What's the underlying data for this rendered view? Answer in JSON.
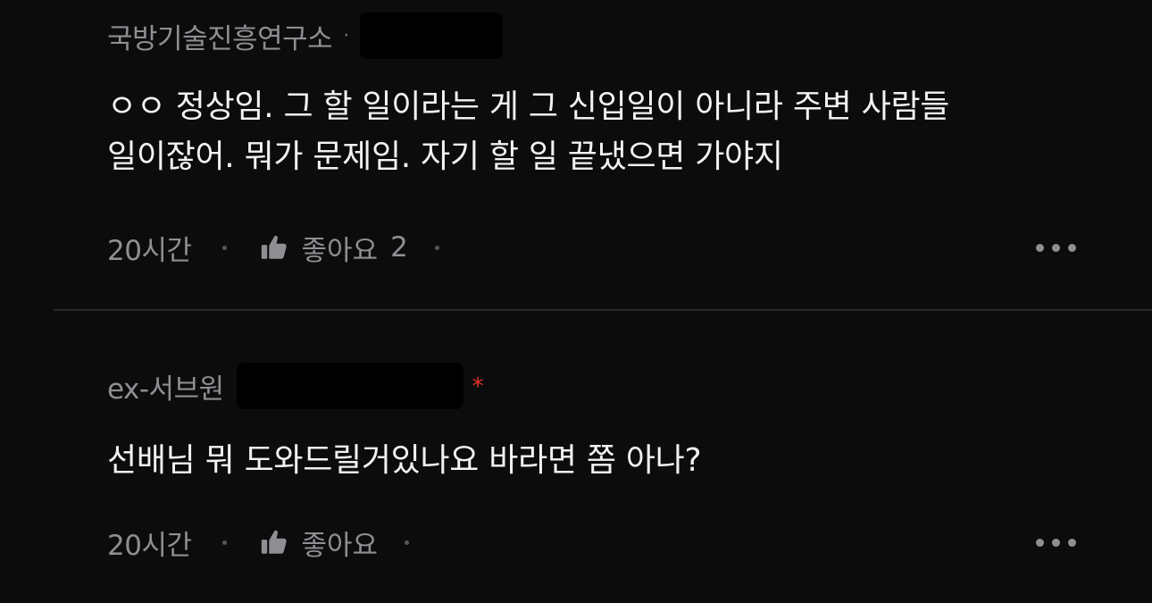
{
  "comments": [
    {
      "author": "국방기술진흥연구소",
      "separator": "·",
      "text": "ㅇㅇ 정상임. 그 할 일이라는 게 그 신입일이 아니라 주변 사람들\n일이잖어. 뭐가 문제임. 자기 할 일 끝냈으면 가야지",
      "time_ago": "20시간",
      "like_label": "좋아요",
      "like_count": "2"
    },
    {
      "author": "ex-서브원",
      "badge": "*",
      "text": "선배님 뭐 도와드릴거있나요 바라면 쫌 아나?",
      "time_ago": "20시간",
      "like_label": "좋아요"
    }
  ],
  "icons": {
    "like": "thumbs-up-icon",
    "more": "more-horizontal-icon"
  },
  "colors": {
    "background": "#0c0c0d",
    "text_primary": "#f2f2f2",
    "text_secondary": "#8e8e93",
    "badge": "#e5342b",
    "divider": "#2a2a2d"
  }
}
